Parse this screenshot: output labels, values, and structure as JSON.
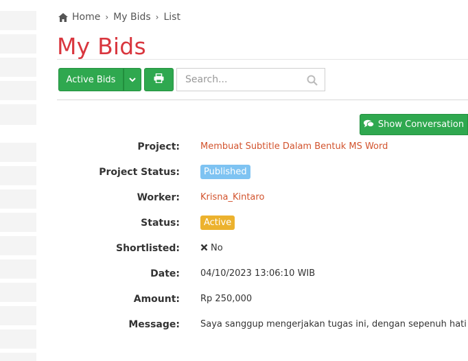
{
  "breadcrumb": {
    "items": [
      "Home",
      "My Bids",
      "List"
    ]
  },
  "page": {
    "title": "My Bids"
  },
  "toolbar": {
    "dropdown_label": "Active Bids",
    "search_placeholder": "Search...",
    "print_icon": "print-icon",
    "search_icon": "search-icon"
  },
  "actions": {
    "show_conversation_label": "Show Conversation",
    "conversation_icon": "comments-icon"
  },
  "details": {
    "project": {
      "label": "Project:",
      "value": "Membuat Subtitle Dalam Bentuk MS Word"
    },
    "project_status": {
      "label": "Project Status:",
      "value": "Published"
    },
    "worker": {
      "label": "Worker:",
      "value": "Krisna_Kintaro"
    },
    "status": {
      "label": "Status:",
      "value": "Active"
    },
    "shortlisted": {
      "label": "Shortlisted:",
      "value": "No"
    },
    "date": {
      "label": "Date:",
      "value": "04/10/2023 13:06:10 WIB"
    },
    "amount": {
      "label": "Amount:",
      "value": "Rp 250,000"
    },
    "message": {
      "label": "Message:",
      "value": "Saya sanggup mengerjakan tugas ini, dengan sepenuh hati"
    }
  },
  "colors": {
    "accent_green": "#2fa84f",
    "title_red": "#d9363e",
    "link_orange": "#d2532d",
    "badge_published": "#7ec3f2",
    "badge_active": "#ecb22e"
  }
}
